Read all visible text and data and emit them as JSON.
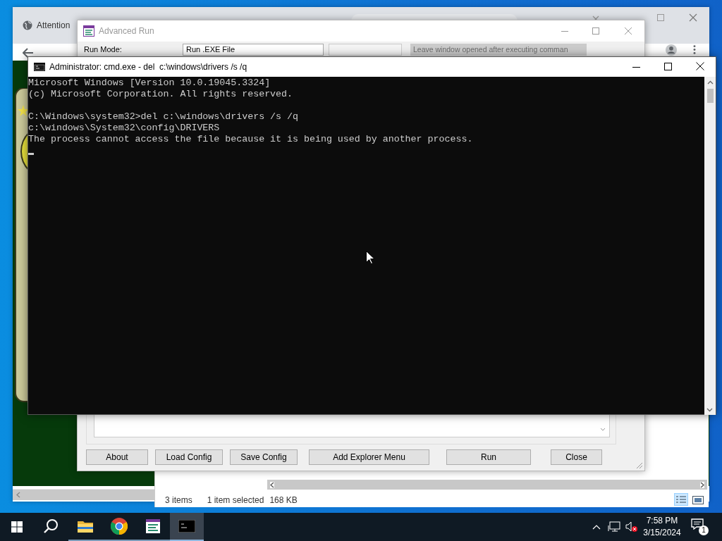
{
  "browser_window": {
    "tab_title": "Attention"
  },
  "explorer_window": {
    "status_bar": {
      "item_count": "3 items",
      "selection": "1 item selected",
      "size": "168 KB"
    }
  },
  "advanced_run_window": {
    "title": "Advanced Run",
    "run_mode_label": "Run Mode:",
    "run_mode_value": "Run .EXE File",
    "leave_open_option": {
      "label": "Leave window opened after executing comman",
      "disabled": true
    },
    "buttons": [
      "About",
      "Load Config",
      "Save Config",
      "Add Explorer Menu",
      "Run",
      "Close"
    ]
  },
  "cmd_window": {
    "title": "Administrator: cmd.exe - del  c:\\windows\\drivers /s /q",
    "blocks": [
      [
        "Microsoft Windows [Version 10.0.19045.3324]",
        "(c) Microsoft Corporation. All rights reserved."
      ],
      [
        "C:\\Windows\\system32>del c:\\windows\\drivers /s /q",
        "c:\\windows\\System32\\config\\DRIVERS",
        "The process cannot access the file because it is being used by another process."
      ]
    ]
  },
  "taskbar": {
    "apps": [
      {
        "kind": "explorer",
        "active": false
      },
      {
        "kind": "browser",
        "active": false
      },
      {
        "kind": "advanced-run",
        "active": false
      },
      {
        "kind": "console",
        "active": true
      }
    ],
    "time": "7:58 PM",
    "date": "3/15/2024",
    "notification_count": "1"
  }
}
